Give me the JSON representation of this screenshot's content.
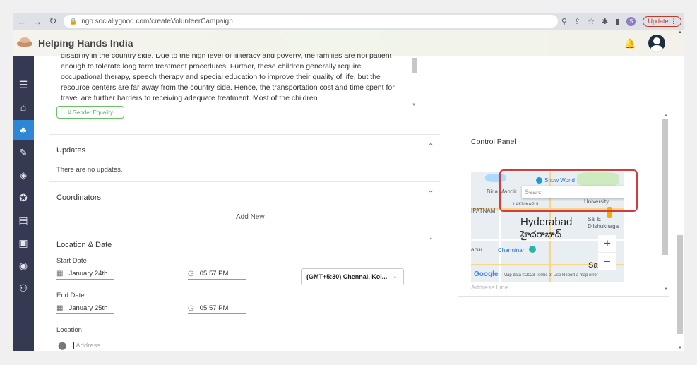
{
  "browser": {
    "url": "ngo.sociallygood.com/createVolunteerCampaign",
    "profile_letter": "S",
    "update_label": "Update"
  },
  "app": {
    "title": "Helping Hands India"
  },
  "campaign": {
    "description": "disability in the country side. Due to the high level of illiteracy and poverty, the families are not patient enough to tolerate long term treatment procedures. Further, these children generally require occupational therapy, speech therapy and special education to improve their quality of life, but the resource centers are far away from the country side. Hence, the transportation cost and time spent for travel are further barriers to receiving adequate treatment. Most of the children",
    "tag": "# Gender Equality"
  },
  "sections": {
    "updates": {
      "title": "Updates",
      "empty": "There are no updates."
    },
    "coordinators": {
      "title": "Coordinators",
      "add_new": "Add New"
    },
    "location_date": {
      "title": "Location & Date",
      "start_label": "Start Date",
      "start_date": "January 24th",
      "start_time": "05:57 PM",
      "timezone": "(GMT+5:30) Chennai, Kol...",
      "end_label": "End Date",
      "end_date": "January 25th",
      "end_time": "05:57 PM",
      "location_label": "Location",
      "address_placeholder": "Address"
    }
  },
  "control_panel": {
    "title": "Control Panel",
    "search_placeholder": "Search",
    "address_line_placeholder": "Address Line",
    "map": {
      "snow_world": "Snow World",
      "birla_mandir": "Birla Mandir",
      "university": "University",
      "lakdikapul": "LAKDIKAPUL",
      "ipatnam": "IPATNAM",
      "city": "Hyderabad",
      "city_telugu": "హైదరాబాద్",
      "sai_e": "Sai E",
      "dilshuknagar": "Dilshuknaga",
      "charminar": "Charminar",
      "apur": "apur",
      "saro": "Sar",
      "footer": "Map data ©2023   Terms of Use   Report a map error",
      "google": "Google"
    }
  },
  "icons": {
    "sidebar": [
      "menu-icon",
      "home-icon",
      "volunteer-icon",
      "campaign-icon",
      "badge-icon",
      "award-icon",
      "contacts-icon",
      "ngo-icon",
      "csr-icon",
      "users-icon"
    ]
  }
}
